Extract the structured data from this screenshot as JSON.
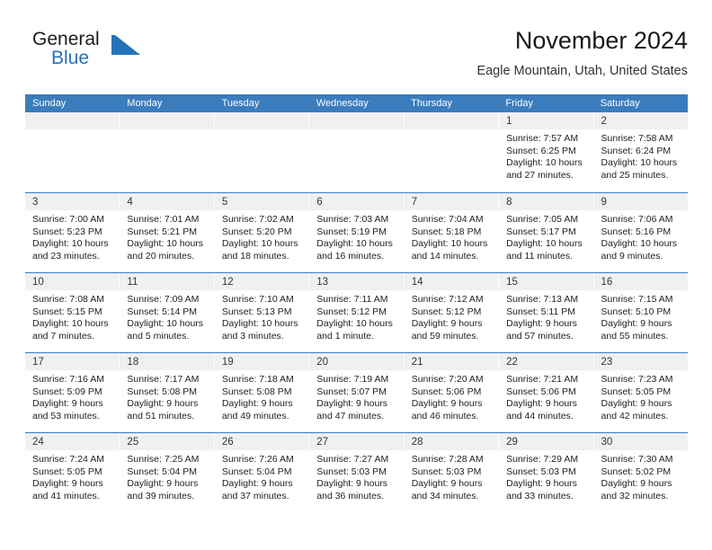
{
  "brand": {
    "name_part1": "General",
    "name_part2": "Blue",
    "mark": "triangle-logo"
  },
  "header": {
    "title": "November 2024",
    "location": "Eagle Mountain, Utah, United States"
  },
  "colors": {
    "header_blue": "#3b7cbd",
    "brand_blue": "#2572b9",
    "day_band_gray": "#f0f0f0",
    "text": "#222222"
  },
  "weekdays": [
    "Sunday",
    "Monday",
    "Tuesday",
    "Wednesday",
    "Thursday",
    "Friday",
    "Saturday"
  ],
  "weeks": [
    [
      {
        "day": "",
        "empty": true,
        "sunrise": "",
        "sunset": "",
        "daylight_1": "",
        "daylight_2": ""
      },
      {
        "day": "",
        "empty": true,
        "sunrise": "",
        "sunset": "",
        "daylight_1": "",
        "daylight_2": ""
      },
      {
        "day": "",
        "empty": true,
        "sunrise": "",
        "sunset": "",
        "daylight_1": "",
        "daylight_2": ""
      },
      {
        "day": "",
        "empty": true,
        "sunrise": "",
        "sunset": "",
        "daylight_1": "",
        "daylight_2": ""
      },
      {
        "day": "",
        "empty": true,
        "sunrise": "",
        "sunset": "",
        "daylight_1": "",
        "daylight_2": ""
      },
      {
        "day": "1",
        "empty": false,
        "sunrise": "Sunrise: 7:57 AM",
        "sunset": "Sunset: 6:25 PM",
        "daylight_1": "Daylight: 10 hours",
        "daylight_2": "and 27 minutes."
      },
      {
        "day": "2",
        "empty": false,
        "sunrise": "Sunrise: 7:58 AM",
        "sunset": "Sunset: 6:24 PM",
        "daylight_1": "Daylight: 10 hours",
        "daylight_2": "and 25 minutes."
      }
    ],
    [
      {
        "day": "3",
        "empty": false,
        "sunrise": "Sunrise: 7:00 AM",
        "sunset": "Sunset: 5:23 PM",
        "daylight_1": "Daylight: 10 hours",
        "daylight_2": "and 23 minutes."
      },
      {
        "day": "4",
        "empty": false,
        "sunrise": "Sunrise: 7:01 AM",
        "sunset": "Sunset: 5:21 PM",
        "daylight_1": "Daylight: 10 hours",
        "daylight_2": "and 20 minutes."
      },
      {
        "day": "5",
        "empty": false,
        "sunrise": "Sunrise: 7:02 AM",
        "sunset": "Sunset: 5:20 PM",
        "daylight_1": "Daylight: 10 hours",
        "daylight_2": "and 18 minutes."
      },
      {
        "day": "6",
        "empty": false,
        "sunrise": "Sunrise: 7:03 AM",
        "sunset": "Sunset: 5:19 PM",
        "daylight_1": "Daylight: 10 hours",
        "daylight_2": "and 16 minutes."
      },
      {
        "day": "7",
        "empty": false,
        "sunrise": "Sunrise: 7:04 AM",
        "sunset": "Sunset: 5:18 PM",
        "daylight_1": "Daylight: 10 hours",
        "daylight_2": "and 14 minutes."
      },
      {
        "day": "8",
        "empty": false,
        "sunrise": "Sunrise: 7:05 AM",
        "sunset": "Sunset: 5:17 PM",
        "daylight_1": "Daylight: 10 hours",
        "daylight_2": "and 11 minutes."
      },
      {
        "day": "9",
        "empty": false,
        "sunrise": "Sunrise: 7:06 AM",
        "sunset": "Sunset: 5:16 PM",
        "daylight_1": "Daylight: 10 hours",
        "daylight_2": "and 9 minutes."
      }
    ],
    [
      {
        "day": "10",
        "empty": false,
        "sunrise": "Sunrise: 7:08 AM",
        "sunset": "Sunset: 5:15 PM",
        "daylight_1": "Daylight: 10 hours",
        "daylight_2": "and 7 minutes."
      },
      {
        "day": "11",
        "empty": false,
        "sunrise": "Sunrise: 7:09 AM",
        "sunset": "Sunset: 5:14 PM",
        "daylight_1": "Daylight: 10 hours",
        "daylight_2": "and 5 minutes."
      },
      {
        "day": "12",
        "empty": false,
        "sunrise": "Sunrise: 7:10 AM",
        "sunset": "Sunset: 5:13 PM",
        "daylight_1": "Daylight: 10 hours",
        "daylight_2": "and 3 minutes."
      },
      {
        "day": "13",
        "empty": false,
        "sunrise": "Sunrise: 7:11 AM",
        "sunset": "Sunset: 5:12 PM",
        "daylight_1": "Daylight: 10 hours",
        "daylight_2": "and 1 minute."
      },
      {
        "day": "14",
        "empty": false,
        "sunrise": "Sunrise: 7:12 AM",
        "sunset": "Sunset: 5:12 PM",
        "daylight_1": "Daylight: 9 hours",
        "daylight_2": "and 59 minutes."
      },
      {
        "day": "15",
        "empty": false,
        "sunrise": "Sunrise: 7:13 AM",
        "sunset": "Sunset: 5:11 PM",
        "daylight_1": "Daylight: 9 hours",
        "daylight_2": "and 57 minutes."
      },
      {
        "day": "16",
        "empty": false,
        "sunrise": "Sunrise: 7:15 AM",
        "sunset": "Sunset: 5:10 PM",
        "daylight_1": "Daylight: 9 hours",
        "daylight_2": "and 55 minutes."
      }
    ],
    [
      {
        "day": "17",
        "empty": false,
        "sunrise": "Sunrise: 7:16 AM",
        "sunset": "Sunset: 5:09 PM",
        "daylight_1": "Daylight: 9 hours",
        "daylight_2": "and 53 minutes."
      },
      {
        "day": "18",
        "empty": false,
        "sunrise": "Sunrise: 7:17 AM",
        "sunset": "Sunset: 5:08 PM",
        "daylight_1": "Daylight: 9 hours",
        "daylight_2": "and 51 minutes."
      },
      {
        "day": "19",
        "empty": false,
        "sunrise": "Sunrise: 7:18 AM",
        "sunset": "Sunset: 5:08 PM",
        "daylight_1": "Daylight: 9 hours",
        "daylight_2": "and 49 minutes."
      },
      {
        "day": "20",
        "empty": false,
        "sunrise": "Sunrise: 7:19 AM",
        "sunset": "Sunset: 5:07 PM",
        "daylight_1": "Daylight: 9 hours",
        "daylight_2": "and 47 minutes."
      },
      {
        "day": "21",
        "empty": false,
        "sunrise": "Sunrise: 7:20 AM",
        "sunset": "Sunset: 5:06 PM",
        "daylight_1": "Daylight: 9 hours",
        "daylight_2": "and 46 minutes."
      },
      {
        "day": "22",
        "empty": false,
        "sunrise": "Sunrise: 7:21 AM",
        "sunset": "Sunset: 5:06 PM",
        "daylight_1": "Daylight: 9 hours",
        "daylight_2": "and 44 minutes."
      },
      {
        "day": "23",
        "empty": false,
        "sunrise": "Sunrise: 7:23 AM",
        "sunset": "Sunset: 5:05 PM",
        "daylight_1": "Daylight: 9 hours",
        "daylight_2": "and 42 minutes."
      }
    ],
    [
      {
        "day": "24",
        "empty": false,
        "sunrise": "Sunrise: 7:24 AM",
        "sunset": "Sunset: 5:05 PM",
        "daylight_1": "Daylight: 9 hours",
        "daylight_2": "and 41 minutes."
      },
      {
        "day": "25",
        "empty": false,
        "sunrise": "Sunrise: 7:25 AM",
        "sunset": "Sunset: 5:04 PM",
        "daylight_1": "Daylight: 9 hours",
        "daylight_2": "and 39 minutes."
      },
      {
        "day": "26",
        "empty": false,
        "sunrise": "Sunrise: 7:26 AM",
        "sunset": "Sunset: 5:04 PM",
        "daylight_1": "Daylight: 9 hours",
        "daylight_2": "and 37 minutes."
      },
      {
        "day": "27",
        "empty": false,
        "sunrise": "Sunrise: 7:27 AM",
        "sunset": "Sunset: 5:03 PM",
        "daylight_1": "Daylight: 9 hours",
        "daylight_2": "and 36 minutes."
      },
      {
        "day": "28",
        "empty": false,
        "sunrise": "Sunrise: 7:28 AM",
        "sunset": "Sunset: 5:03 PM",
        "daylight_1": "Daylight: 9 hours",
        "daylight_2": "and 34 minutes."
      },
      {
        "day": "29",
        "empty": false,
        "sunrise": "Sunrise: 7:29 AM",
        "sunset": "Sunset: 5:03 PM",
        "daylight_1": "Daylight: 9 hours",
        "daylight_2": "and 33 minutes."
      },
      {
        "day": "30",
        "empty": false,
        "sunrise": "Sunrise: 7:30 AM",
        "sunset": "Sunset: 5:02 PM",
        "daylight_1": "Daylight: 9 hours",
        "daylight_2": "and 32 minutes."
      }
    ]
  ]
}
